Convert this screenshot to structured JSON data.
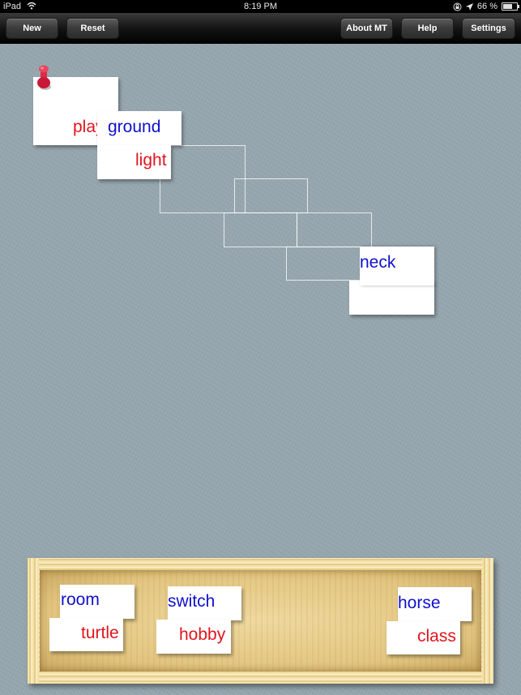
{
  "status_bar": {
    "device": "iPad",
    "time": "8:19 PM",
    "battery_percent": "66 %",
    "battery_level": 0.66,
    "icons": [
      "wifi-icon",
      "rotation-lock-icon",
      "location-arrow-icon",
      "battery-icon"
    ]
  },
  "toolbar": {
    "left_buttons": [
      {
        "label": "New"
      },
      {
        "label": "Reset"
      }
    ],
    "right_buttons": [
      {
        "label": "About MT"
      },
      {
        "label": "Help"
      },
      {
        "label": "Settings"
      }
    ]
  },
  "board": {
    "placed_cards": [
      {
        "word": "play",
        "color": "red"
      },
      {
        "word": "ground",
        "color": "blue"
      },
      {
        "word": "light",
        "color": "red"
      },
      {
        "word": "neck",
        "color": "blue"
      }
    ],
    "empty_slots": 5,
    "pin_color": "#d6223f"
  },
  "tray": {
    "cards": [
      {
        "word": "room",
        "color": "blue"
      },
      {
        "word": "turtle",
        "color": "red"
      },
      {
        "word": "switch",
        "color": "blue"
      },
      {
        "word": "hobby",
        "color": "red"
      },
      {
        "word": "horse",
        "color": "blue"
      },
      {
        "word": "class",
        "color": "red"
      }
    ]
  },
  "colors": {
    "red_word": "#e0141c",
    "blue_word": "#1010cc",
    "background": "#96a6ae",
    "tray_wood": "#e8cf8f"
  }
}
